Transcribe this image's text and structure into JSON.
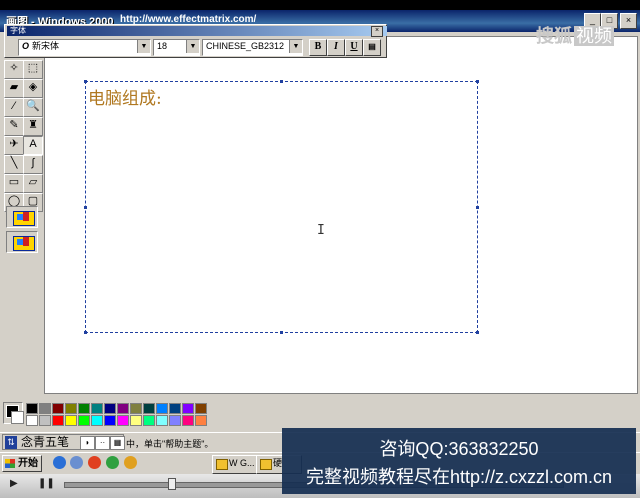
{
  "window": {
    "title": "画图 - Windows 2000",
    "url": "http://www.effectmatrix.com/",
    "minimize": "_",
    "maximize": "□",
    "close": "×"
  },
  "font_toolbar": {
    "caption": "字体",
    "close": "×",
    "font_name": "新宋体",
    "font_size": "18",
    "script": "CHINESE_GB2312",
    "bold": "B",
    "italic": "I",
    "underline": "U"
  },
  "tools": [
    {
      "name": "free-select-tool",
      "glyph": "✧"
    },
    {
      "name": "rect-select-tool",
      "glyph": "⬚"
    },
    {
      "name": "eraser-tool",
      "glyph": "▰"
    },
    {
      "name": "fill-tool",
      "glyph": "◈"
    },
    {
      "name": "color-picker-tool",
      "glyph": "⁄"
    },
    {
      "name": "magnifier-tool",
      "glyph": "🔍"
    },
    {
      "name": "pencil-tool",
      "glyph": "✎"
    },
    {
      "name": "brush-tool",
      "glyph": "♜"
    },
    {
      "name": "airbrush-tool",
      "glyph": "✈"
    },
    {
      "name": "text-tool",
      "glyph": "A"
    },
    {
      "name": "line-tool",
      "glyph": "╲"
    },
    {
      "name": "curve-tool",
      "glyph": "∫"
    },
    {
      "name": "rectangle-tool",
      "glyph": "▭"
    },
    {
      "name": "polygon-tool",
      "glyph": "▱"
    },
    {
      "name": "ellipse-tool",
      "glyph": "◯"
    },
    {
      "name": "rounded-rect-tool",
      "glyph": "▢"
    }
  ],
  "canvas": {
    "text": "电脑组成:",
    "text_color": "#b07820",
    "cursor": "I"
  },
  "watermark": {
    "brand": "搜狐",
    "tag": "视频"
  },
  "palette": [
    "#000000",
    "#808080",
    "#800000",
    "#808000",
    "#008000",
    "#008080",
    "#000080",
    "#800080",
    "#808040",
    "#004040",
    "#0080ff",
    "#004080",
    "#8000ff",
    "#804000",
    "#ffffff",
    "#c0c0c0",
    "#ff0000",
    "#ffff00",
    "#00ff00",
    "#00ffff",
    "#0000ff",
    "#ff00ff",
    "#ffff80",
    "#00ff80",
    "#80ffff",
    "#8080ff",
    "#ff0080",
    "#ff8040"
  ],
  "status": {
    "ime_label": "念青五笔",
    "ime_k1": "◗",
    "ime_k2": "··",
    "ime_k3": "▦",
    "help_text": "中，单击\"帮助主题\"。"
  },
  "taskbar": {
    "start": "开始",
    "tasks": [
      "W G...",
      "硬"
    ]
  },
  "ad": {
    "line1": "咨询QQ:363832250",
    "line2": "完整视频教程尽在http://z.cxzzl.com.cn"
  },
  "player": {
    "play": "▶",
    "pause": "❚❚"
  }
}
